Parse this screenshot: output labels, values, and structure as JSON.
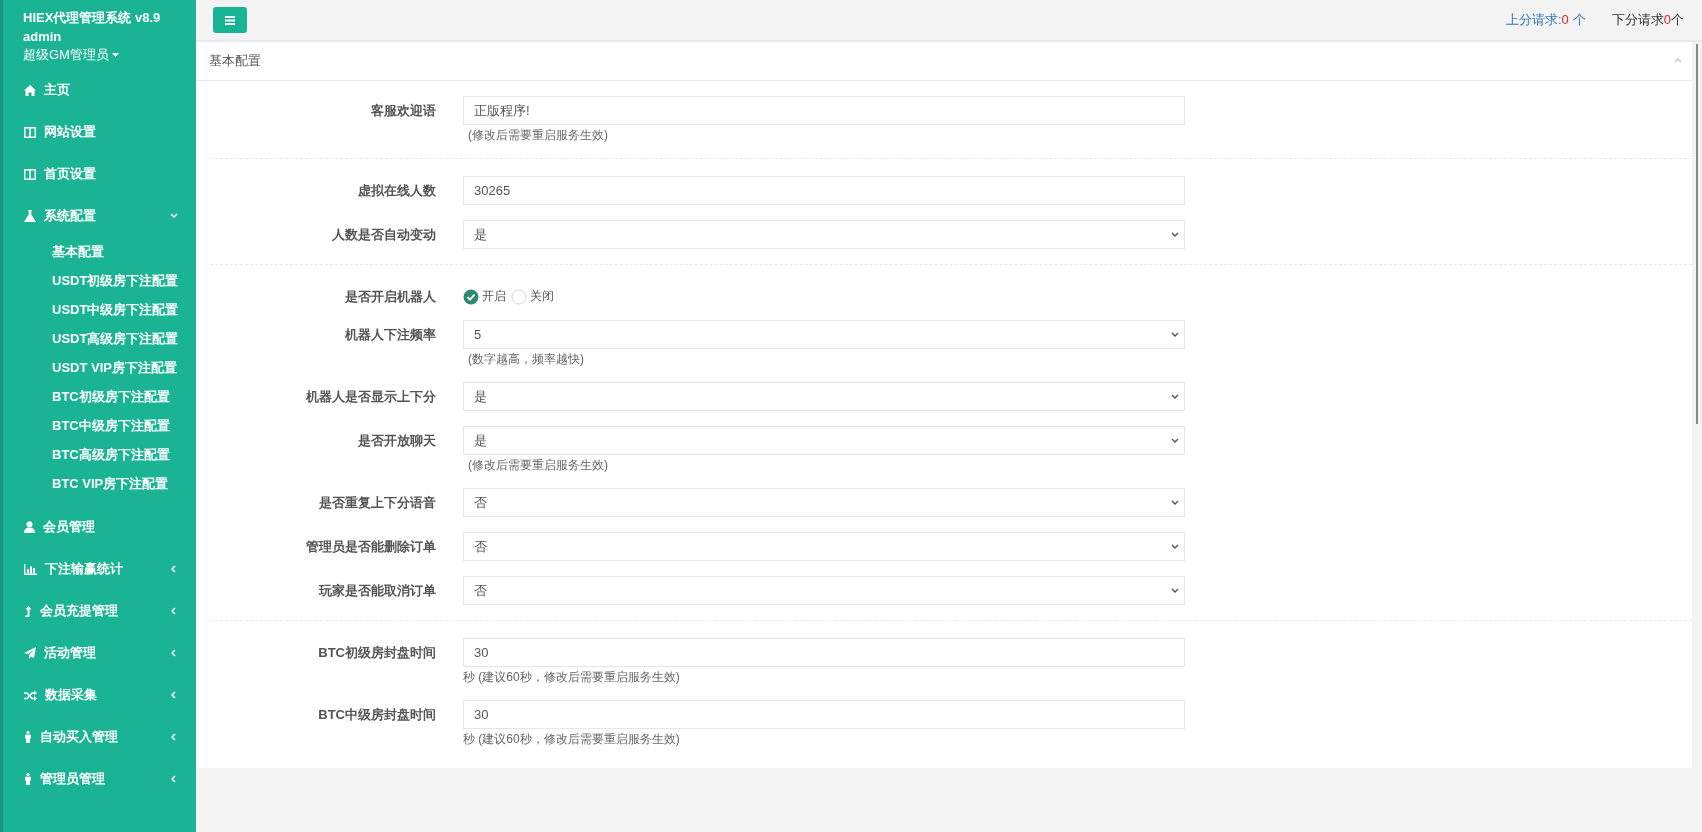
{
  "sidebar": {
    "title": "HIEX代理管理系统 v8.9",
    "user": "admin",
    "role": "超级GM管理员",
    "items": [
      {
        "label": "主页"
      },
      {
        "label": "网站设置"
      },
      {
        "label": "首页设置"
      },
      {
        "label": "系统配置",
        "expanded": true,
        "children": [
          {
            "label": "基本配置"
          },
          {
            "label": "USDT初级房下注配置"
          },
          {
            "label": "USDT中级房下注配置"
          },
          {
            "label": "USDT高级房下注配置"
          },
          {
            "label": "USDT VIP房下注配置"
          },
          {
            "label": "BTC初级房下注配置"
          },
          {
            "label": "BTC中级房下注配置"
          },
          {
            "label": "BTC高级房下注配置"
          },
          {
            "label": "BTC VIP房下注配置"
          }
        ]
      },
      {
        "label": "会员管理"
      },
      {
        "label": "下注输赢统计",
        "expanded": false
      },
      {
        "label": "会员充提管理",
        "expanded": false
      },
      {
        "label": "活动管理",
        "expanded": false
      },
      {
        "label": "数据采集",
        "expanded": false
      },
      {
        "label": "自动买入管理",
        "expanded": false
      },
      {
        "label": "管理员管理",
        "expanded": false
      }
    ]
  },
  "topbar": {
    "requests": [
      {
        "label": "上分请求:",
        "count": "0",
        "unit": "个",
        "kind": "link"
      },
      {
        "label": "下分请求",
        "count": "0",
        "unit": "个",
        "kind": "plain"
      }
    ]
  },
  "panel": {
    "title": "基本配置",
    "groups": [
      {
        "fields": [
          {
            "kind": "text",
            "label": "客服欢迎语",
            "value": "正版程序!",
            "help": "(修改后需要重启服务生效)"
          }
        ]
      },
      {
        "fields": [
          {
            "kind": "text",
            "label": "虚拟在线人数",
            "value": "30265"
          },
          {
            "kind": "select",
            "label": "人数是否自动变动",
            "value": "是"
          }
        ]
      },
      {
        "fields": [
          {
            "kind": "radio",
            "label": "是否开启机器人",
            "options": [
              {
                "label": "开启",
                "selected": true
              },
              {
                "label": "关闭",
                "selected": false
              }
            ]
          },
          {
            "kind": "select",
            "label": "机器人下注频率",
            "value": "5",
            "help": "(数字越高，频率越快)"
          },
          {
            "kind": "select",
            "label": "机器人是否显示上下分",
            "value": "是"
          },
          {
            "kind": "select",
            "label": "是否开放聊天",
            "value": "是",
            "help": "(修改后需要重启服务生效)"
          },
          {
            "kind": "select",
            "label": "是否重复上下分语音",
            "value": "否"
          },
          {
            "kind": "select",
            "label": "管理员是否能删除订单",
            "value": "否"
          },
          {
            "kind": "select",
            "label": "玩家是否能取消订单",
            "value": "否"
          }
        ]
      },
      {
        "fields": [
          {
            "kind": "text",
            "label": "BTC初级房封盘时间",
            "value": "30",
            "unit_help": "秒 (建议60秒，修改后需要重启服务生效)"
          },
          {
            "kind": "text",
            "label": "BTC中级房封盘时间",
            "value": "30",
            "unit_help": "秒 (建议60秒，修改后需要重启服务生效)"
          }
        ]
      }
    ]
  }
}
